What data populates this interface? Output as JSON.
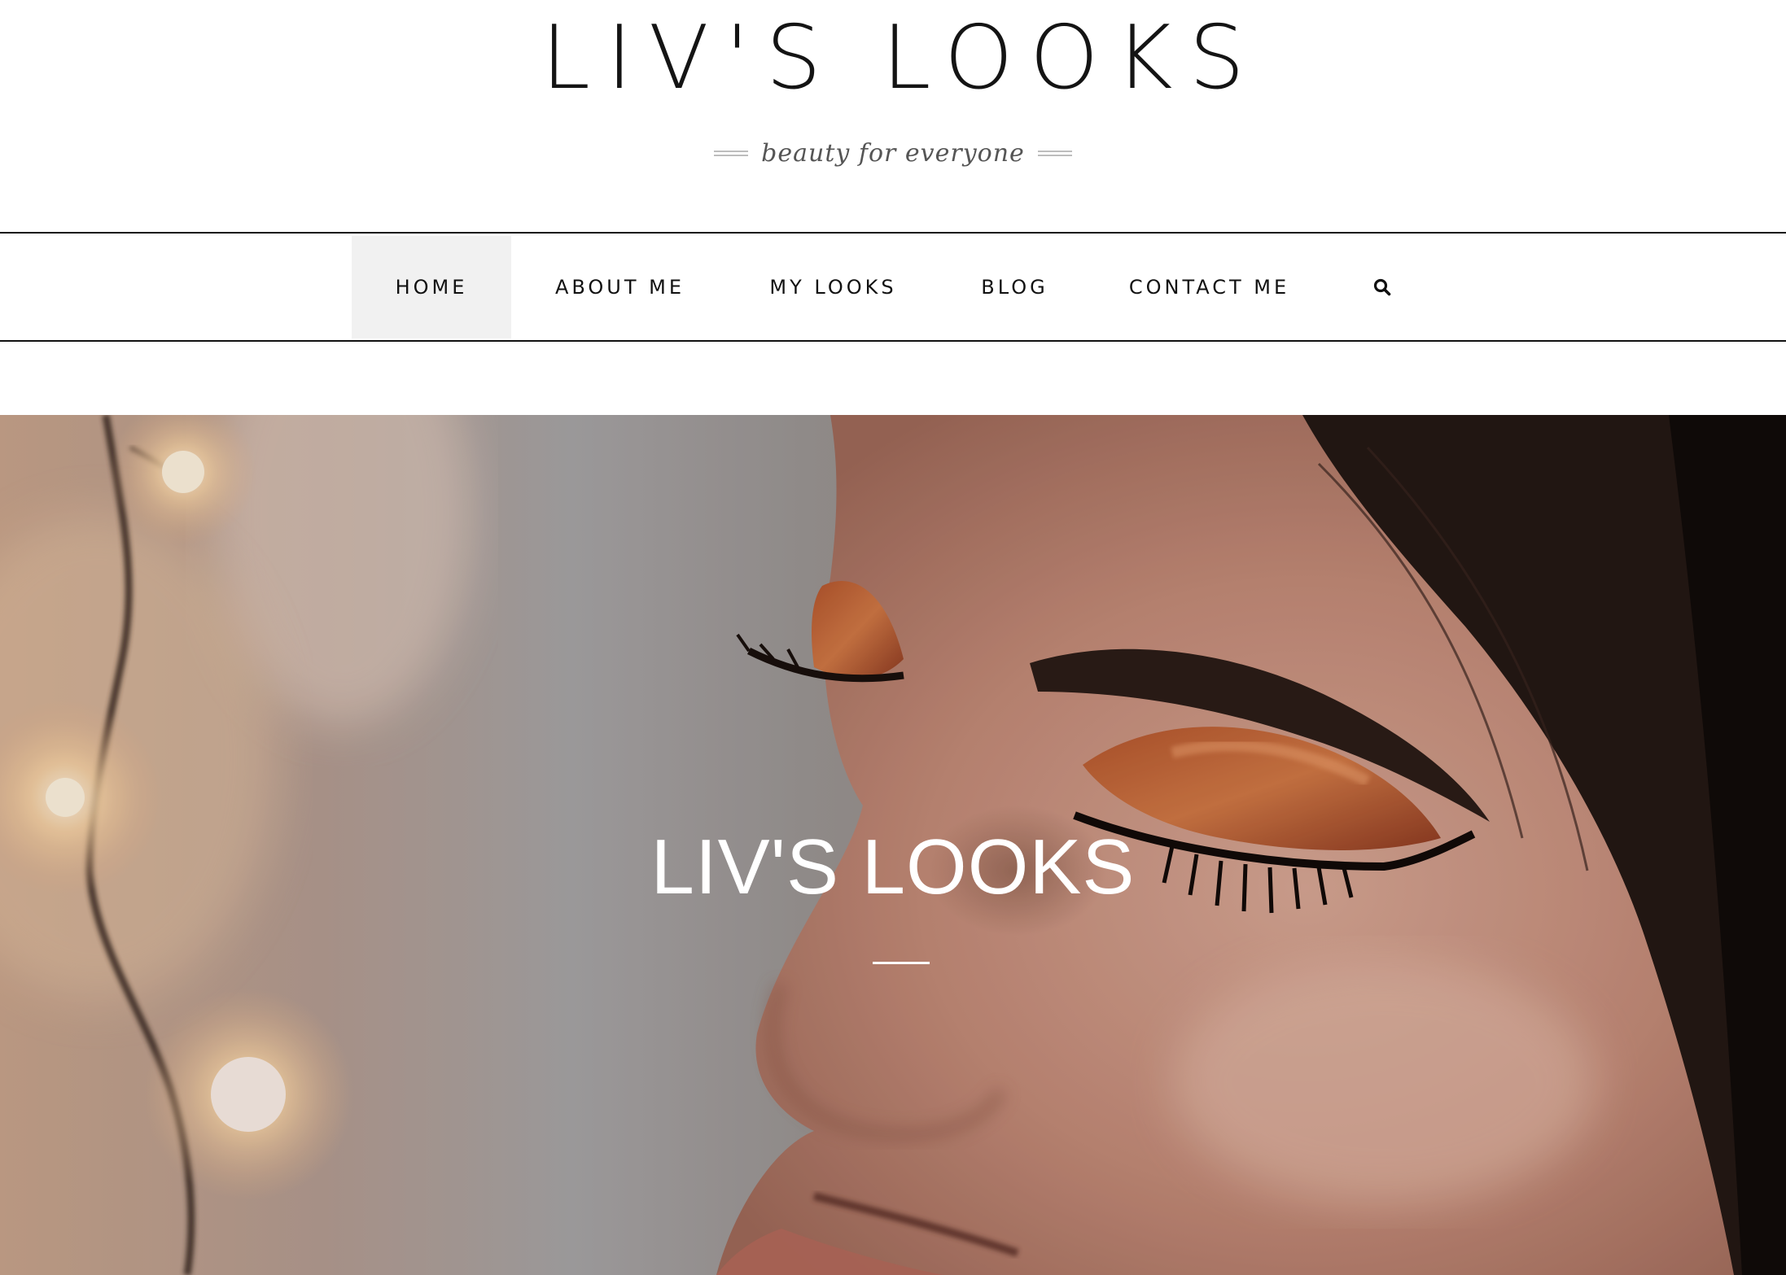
{
  "header": {
    "site_title": "LIV'S LOOKS",
    "tagline": "beauty for everyone"
  },
  "nav": {
    "items": [
      {
        "label": "HOME",
        "active": true
      },
      {
        "label": "ABOUT ME",
        "active": false
      },
      {
        "label": "MY LOOKS",
        "active": false
      },
      {
        "label": "BLOG",
        "active": false
      },
      {
        "label": "CONTACT ME",
        "active": false
      }
    ],
    "search_icon": "search-icon"
  },
  "hero": {
    "title": "LIV'S LOOKS",
    "image": "close-up portrait with copper eyeshadow and string lights"
  },
  "colors": {
    "text": "#111111",
    "active_nav_bg": "#f1f1f1",
    "tagline": "#555555",
    "hero_text": "#ffffff"
  }
}
